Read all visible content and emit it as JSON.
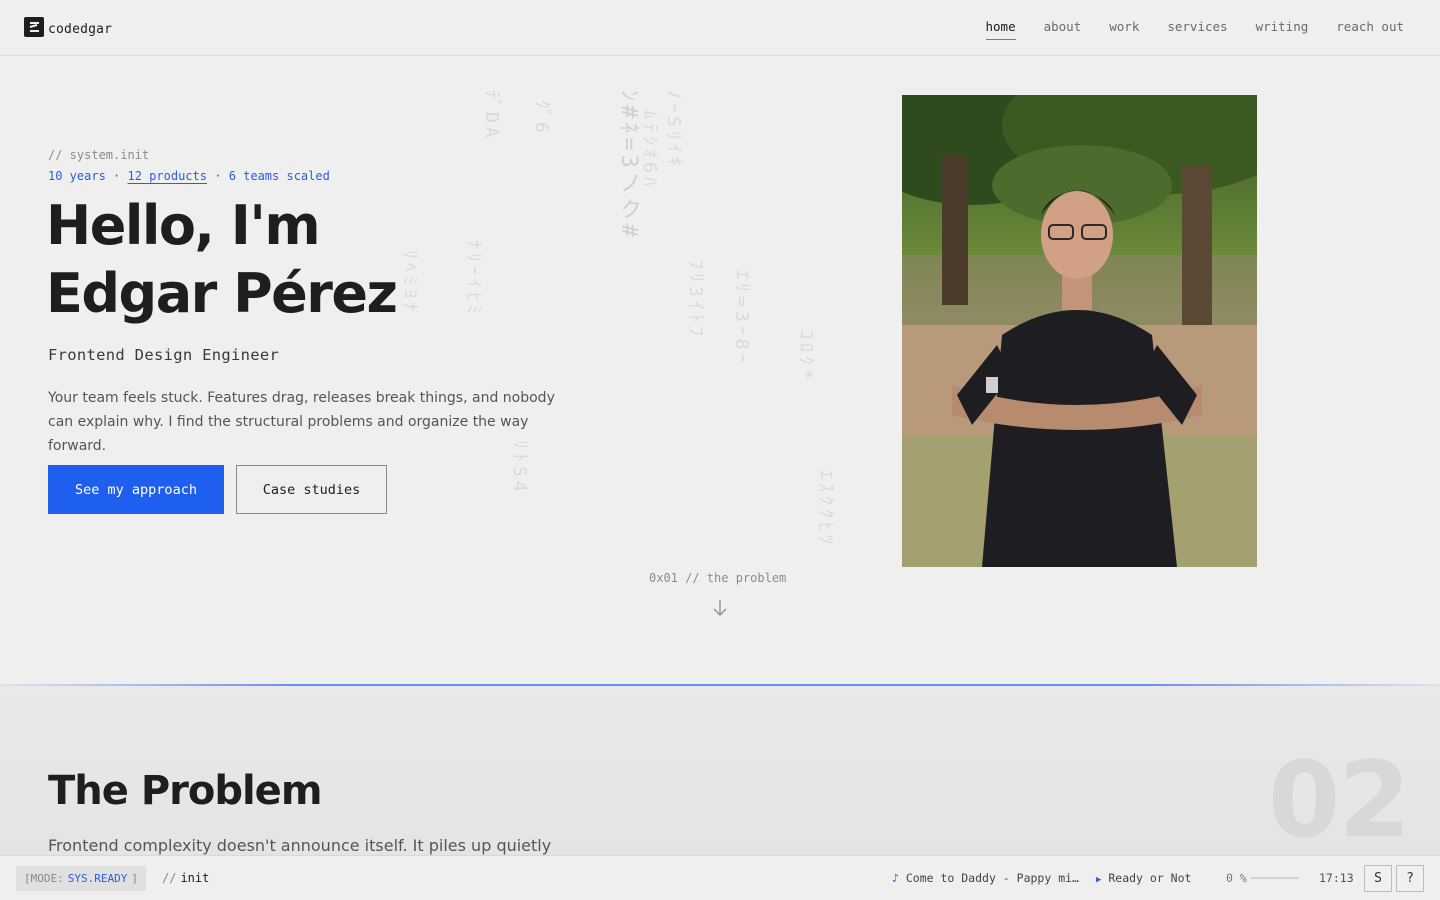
{
  "brand": {
    "name": "codedgar"
  },
  "nav": [
    {
      "label": "home",
      "active": true
    },
    {
      "label": "about",
      "active": false
    },
    {
      "label": "work",
      "active": false
    },
    {
      "label": "services",
      "active": false
    },
    {
      "label": "writing",
      "active": false
    },
    {
      "label": "reach out",
      "active": false
    }
  ],
  "hero": {
    "tag": "// system.init",
    "stat_years": "10 years",
    "stat_products": "12 products",
    "stat_teams": "6 teams scaled",
    "separator": "·",
    "greeting": "Hello, I'm",
    "name": "Edgar Pérez",
    "role": "Frontend Design Engineer",
    "description": "Your team feels stuck. Features drag, releases break things, and nobody can explain why. I find the structural problems and organize the way forward.",
    "primary_button": "See my approach",
    "secondary_button": "Case studies",
    "scroll_hint": "0x01 // the problem"
  },
  "section2": {
    "title": "The Problem",
    "number": "02",
    "intro": "Frontend complexity doesn't announce itself. It piles up quietly"
  },
  "status": {
    "mode_label": "[MODE:",
    "mode_value": "SYS.READY",
    "mode_close": "]",
    "crumb_prefix": "//",
    "crumb_value": "init",
    "track_icon": "♪",
    "track": "Come to Daddy - Pappy mi…",
    "game_icon": "▶",
    "game": "Ready or Not",
    "volume": "0 %",
    "time": "17:13",
    "s_button": "S",
    "help_button": "?"
  },
  "colors": {
    "accent": "#1f5ff0",
    "active_underline": "#e5533a"
  }
}
